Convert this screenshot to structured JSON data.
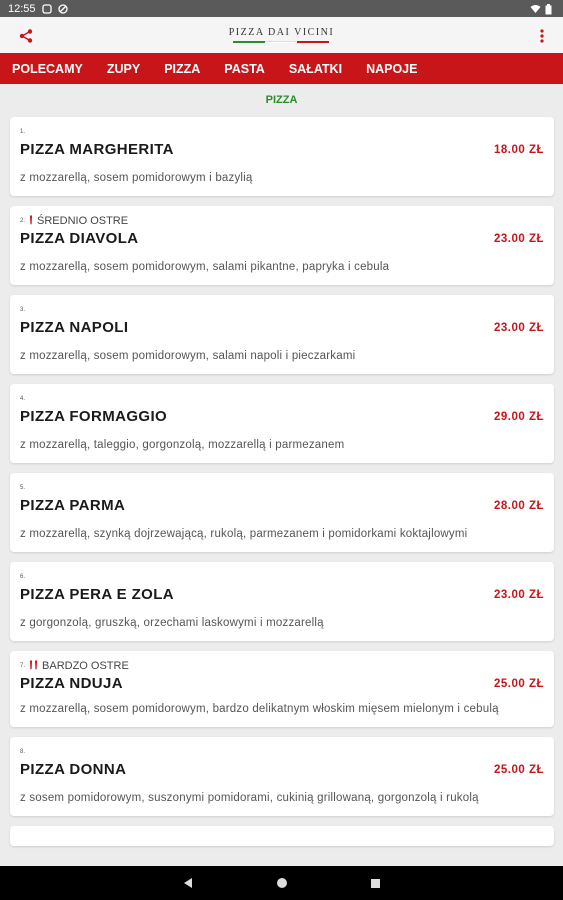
{
  "status": {
    "time": "12:55"
  },
  "appbar": {
    "logo_text": "PIZZA DAI VICINI",
    "share_icon": "share-icon",
    "menu_icon": "more-vert-icon"
  },
  "nav": [
    "POLECAMY",
    "ZUPY",
    "PIZZA",
    "PASTA",
    "SAŁATKI",
    "NAPOJE"
  ],
  "section": {
    "title": "PIZZA"
  },
  "colors": {
    "brand_red": "#c8151a",
    "section_green": "#2e8b2e"
  },
  "menu": [
    {
      "num": "1.",
      "name": "PIZZA MARGHERITA",
      "price": "18.00 ZŁ",
      "desc": "z mozzarellą, sosem pomidorowym i bazylią",
      "spice": ""
    },
    {
      "num": "2.",
      "name": "PIZZA DIAVOLA",
      "price": "23.00 ZŁ",
      "desc": "z mozzarellą, sosem pomidorowym, salami pikantne, papryka i cebula",
      "spice": "ŚREDNIO OSTRE",
      "spice_icon": "chili-icon"
    },
    {
      "num": "3.",
      "name": "PIZZA NAPOLI",
      "price": "23.00 ZŁ",
      "desc": "z mozzarellą, sosem pomidorowym, salami napoli i pieczarkami",
      "spice": ""
    },
    {
      "num": "4.",
      "name": "PIZZA FORMAGGIO",
      "price": "29.00 ZŁ",
      "desc": "z mozzarellą, taleggio, gorgonzolą, mozzarellą i parmezanem",
      "spice": ""
    },
    {
      "num": "5.",
      "name": "PIZZA PARMA",
      "price": "28.00 ZŁ",
      "desc": "z mozzarellą, szynką dojrzewającą, rukolą, parmezanem i pomidorkami koktajlowymi",
      "spice": ""
    },
    {
      "num": "6.",
      "name": "PIZZA PERA E ZOLA",
      "price": "23.00 ZŁ",
      "desc": "z gorgonzolą, gruszką, orzechami laskowymi i mozzarellą",
      "spice": ""
    },
    {
      "num": "7.",
      "name": "PIZZA NDUJA",
      "price": "25.00 ZŁ",
      "desc": "z mozzarellą, sosem pomidorowym, bardzo delikatnym włoskim mięsem mielonym i cebulą",
      "spice": "BARDZO OSTRE",
      "spice_icon": "double-chili-icon"
    },
    {
      "num": "8.",
      "name": "PIZZA DONNA",
      "price": "25.00 ZŁ",
      "desc": "z sosem pomidorowym, suszonymi pomidorami, cukinią grillowaną, gorgonzolą i rukolą",
      "spice": ""
    }
  ]
}
